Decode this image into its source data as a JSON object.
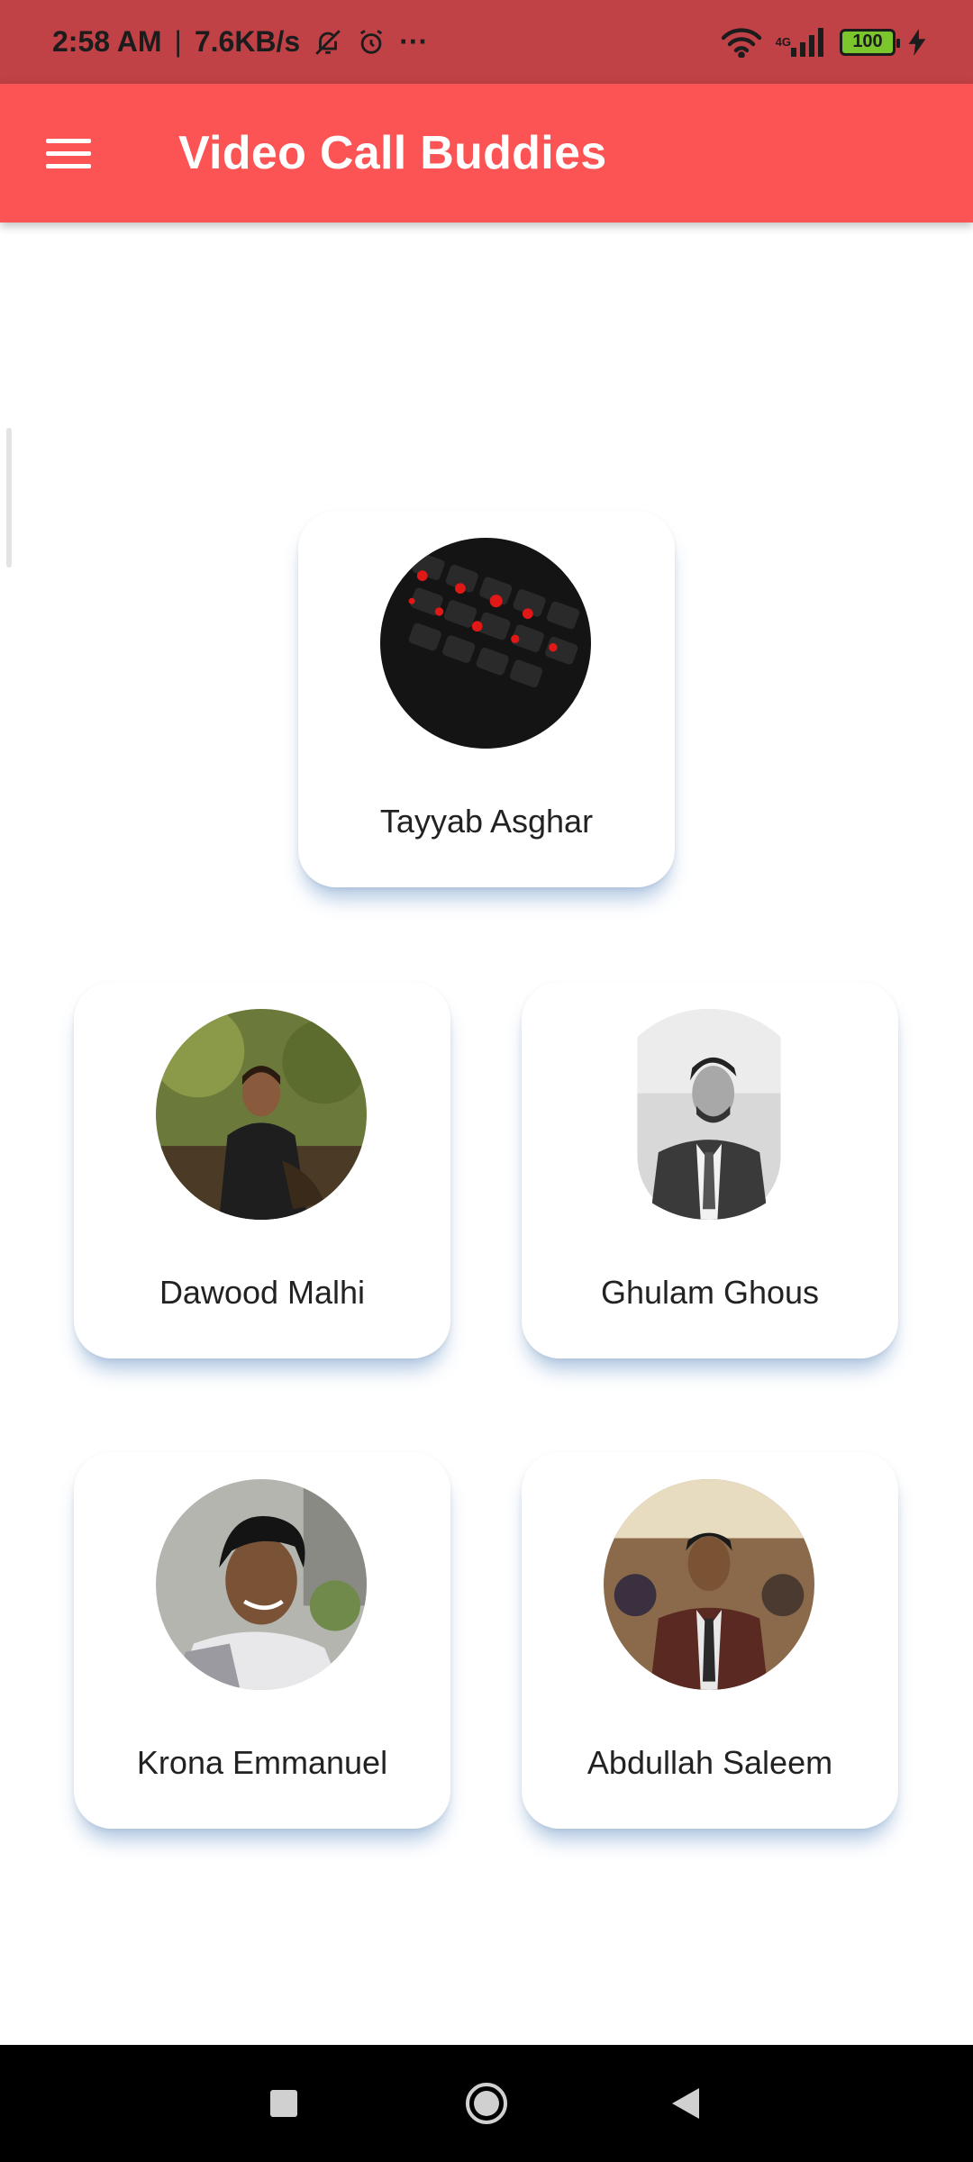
{
  "status_bar": {
    "time": "2:58 AM",
    "separator": "|",
    "speed": "7.6KB/s",
    "more": "···",
    "network_type": "4G",
    "battery": "100"
  },
  "app_bar": {
    "title": "Video Call Buddies",
    "menu_icon": "hamburger-menu-icon"
  },
  "buddies": [
    {
      "name": "Tayyab Asghar",
      "avatar": "keyboard-red-backlight-photo"
    },
    {
      "name": "Dawood Malhi",
      "avatar": "man-outdoors-photo"
    },
    {
      "name": "Ghulam Ghous",
      "avatar": "man-in-suit-bw-photo"
    },
    {
      "name": "Krona Emmanuel",
      "avatar": "man-smiling-photo"
    },
    {
      "name": "Abdullah Saleem",
      "avatar": "man-in-suit-event-photo"
    }
  ],
  "nav_bar": {
    "recent_icon": "square-recents-icon",
    "home_icon": "circle-home-icon",
    "back_icon": "triangle-back-icon"
  },
  "colors": {
    "status_bar": "#c04146",
    "app_bar": "#fc5454",
    "card_shadow": "#5082be",
    "battery": "#7bc62d"
  }
}
